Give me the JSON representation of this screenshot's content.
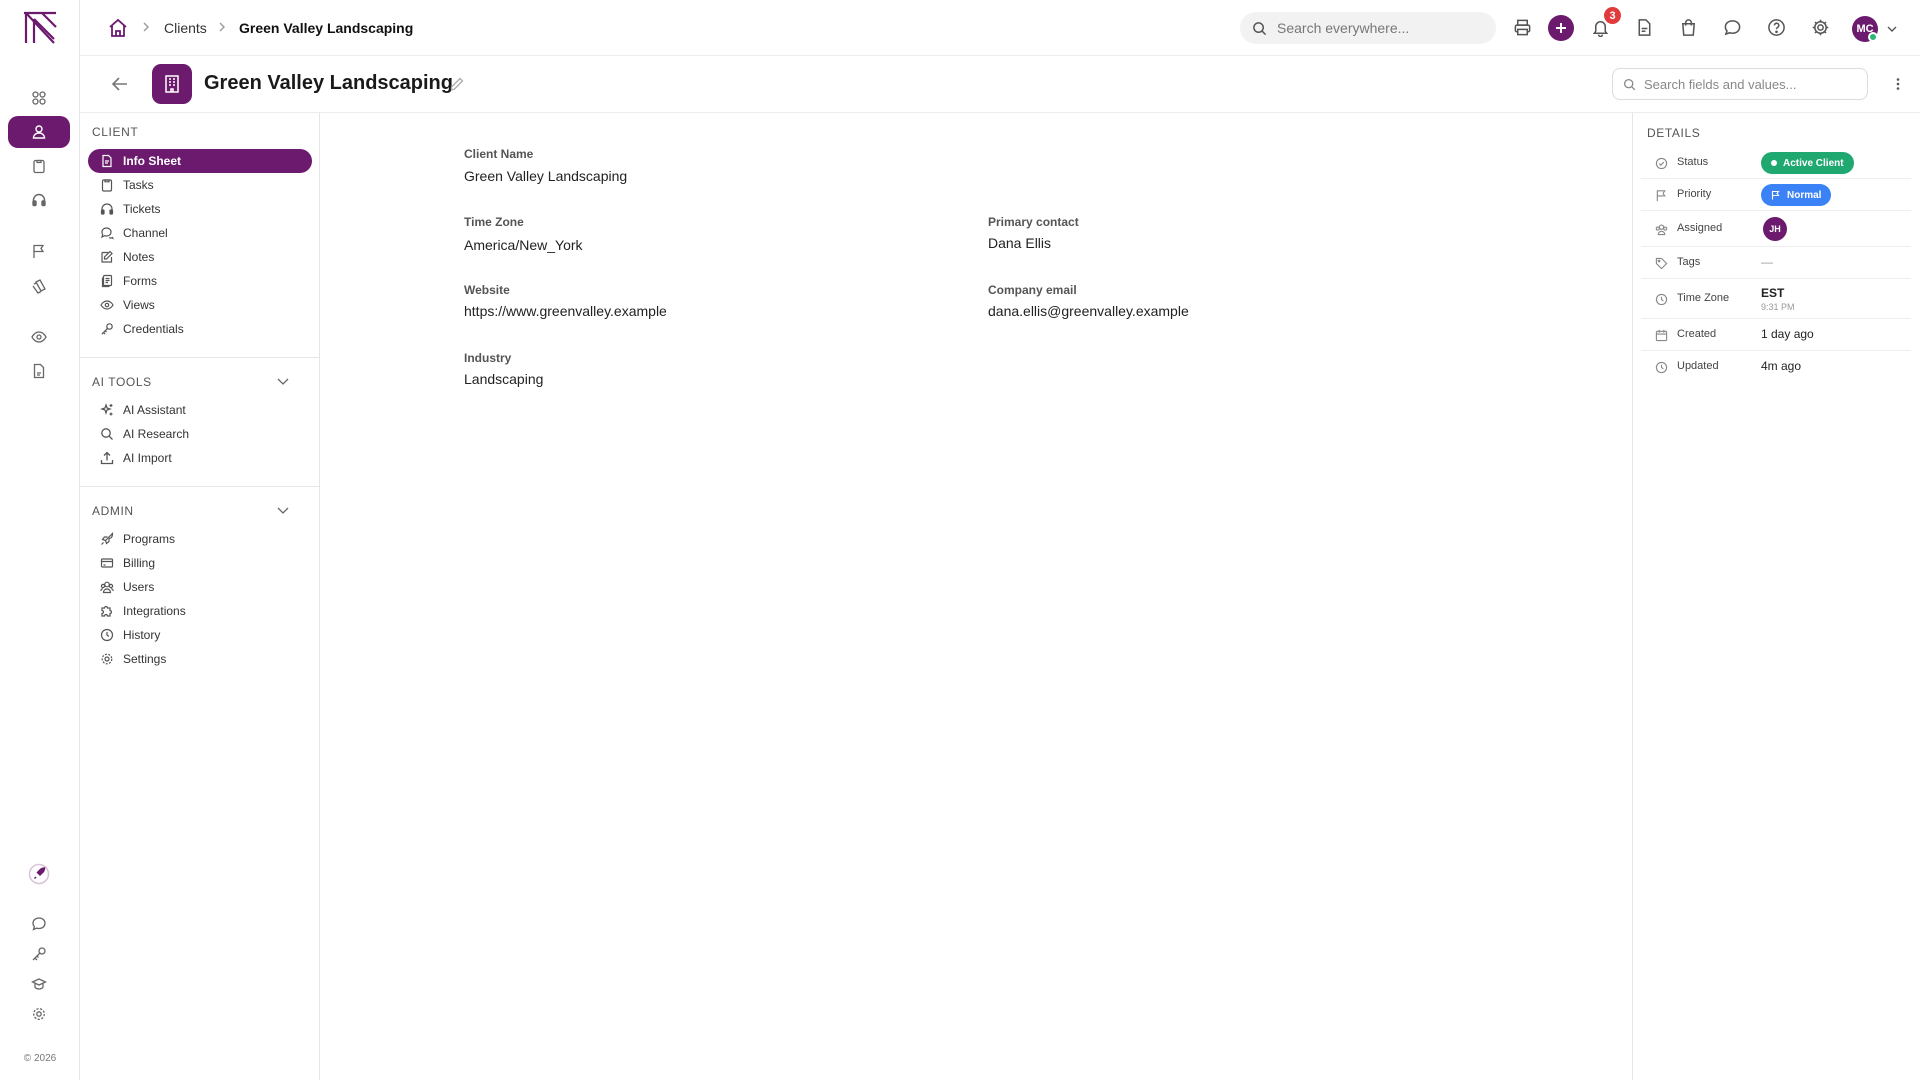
{
  "app": {
    "copyright": "© 2026"
  },
  "breadcrumb": {
    "section": "Clients",
    "current": "Green Valley Landscaping"
  },
  "search": {
    "placeholder": "Search everywhere..."
  },
  "notifications": {
    "count": "3"
  },
  "user": {
    "initials": "MC"
  },
  "page": {
    "title": "Green Valley Landscaping",
    "field_search_placeholder": "Search fields and values..."
  },
  "sidebar": {
    "client_header": "CLIENT",
    "client_items": [
      {
        "label": "Info Sheet",
        "icon": "file-icon"
      },
      {
        "label": "Tasks",
        "icon": "clipboard-icon"
      },
      {
        "label": "Tickets",
        "icon": "headset-icon"
      },
      {
        "label": "Channel",
        "icon": "chat-icon"
      },
      {
        "label": "Notes",
        "icon": "pencil-icon"
      },
      {
        "label": "Forms",
        "icon": "forms-icon"
      },
      {
        "label": "Views",
        "icon": "eye-icon"
      },
      {
        "label": "Credentials",
        "icon": "key-icon"
      }
    ],
    "ai_header": "AI TOOLS",
    "ai_items": [
      {
        "label": "AI Assistant",
        "icon": "sparkles-icon"
      },
      {
        "label": "AI Research",
        "icon": "search-icon"
      },
      {
        "label": "AI Import",
        "icon": "upload-icon"
      }
    ],
    "admin_header": "ADMIN",
    "admin_items": [
      {
        "label": "Programs",
        "icon": "rocket-icon"
      },
      {
        "label": "Billing",
        "icon": "card-icon"
      },
      {
        "label": "Users",
        "icon": "users-icon"
      },
      {
        "label": "Integrations",
        "icon": "puzzle-icon"
      },
      {
        "label": "History",
        "icon": "clock-icon"
      },
      {
        "label": "Settings",
        "icon": "gear-icon"
      }
    ]
  },
  "fields": {
    "client_name": {
      "label": "Client Name",
      "value": "Green Valley Landscaping"
    },
    "time_zone": {
      "label": "Time Zone",
      "value": "America/New_York"
    },
    "primary_contact": {
      "label": "Primary contact",
      "value": "Dana Ellis"
    },
    "website": {
      "label": "Website",
      "value": "https://www.greenvalley.example"
    },
    "company_email": {
      "label": "Company email",
      "value": "dana.ellis@greenvalley.example"
    },
    "industry": {
      "label": "Industry",
      "value": "Landscaping"
    }
  },
  "details": {
    "header": "DETAILS",
    "status": {
      "label": "Status",
      "value": "Active Client",
      "color": "#1fa971"
    },
    "priority": {
      "label": "Priority",
      "value": "Normal",
      "color": "#3b82f6"
    },
    "assigned": {
      "label": "Assigned",
      "initials": "JH"
    },
    "tags": {
      "label": "Tags",
      "value": "—"
    },
    "time_zone": {
      "label": "Time Zone",
      "value": "EST",
      "sub": "9:31 PM"
    },
    "created": {
      "label": "Created",
      "value": "1 day ago"
    },
    "updated": {
      "label": "Updated",
      "value": "4m ago"
    }
  },
  "theme": {
    "accent": "#6b1a6e"
  }
}
